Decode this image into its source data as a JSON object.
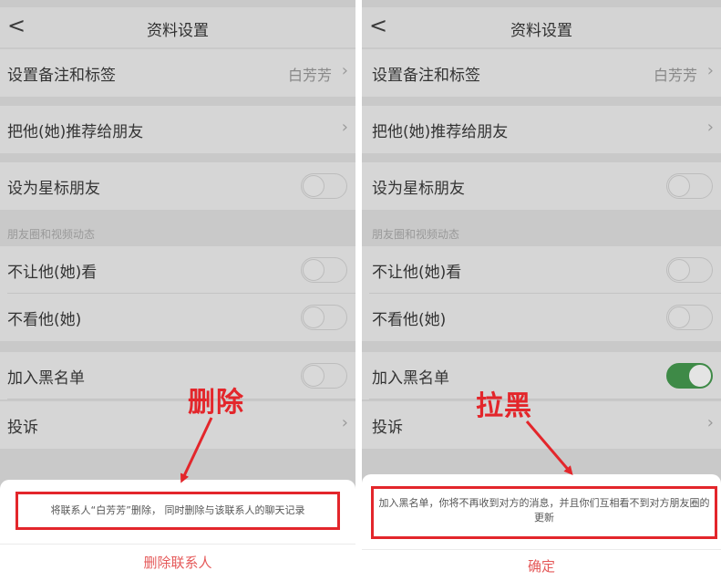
{
  "left": {
    "nav": {
      "back": "<",
      "title": "资料设置"
    },
    "rows": {
      "remark": {
        "label": "设置备注和标签",
        "value": "白芳芳"
      },
      "recommend": {
        "label": "把他(她)推荐给朋友"
      },
      "star": {
        "label": "设为星标朋友",
        "on": false
      },
      "section": "朋友圈和视频动态",
      "hide_from": {
        "label": "不让他(她)看",
        "on": false
      },
      "hide_theirs": {
        "label": "不看他(她)",
        "on": false
      },
      "blacklist": {
        "label": "加入黑名单",
        "on": false
      },
      "report": {
        "label": "投诉"
      }
    },
    "annotation": "删除",
    "sheet": {
      "message": "将联系人“白芳芳”删除， 同时删除与该联系人的聊天记录",
      "action": "删除联系人"
    }
  },
  "right": {
    "nav": {
      "back": "<",
      "title": "资料设置"
    },
    "rows": {
      "remark": {
        "label": "设置备注和标签",
        "value": "白芳芳"
      },
      "recommend": {
        "label": "把他(她)推荐给朋友"
      },
      "star": {
        "label": "设为星标朋友",
        "on": false
      },
      "section": "朋友圈和视频动态",
      "hide_from": {
        "label": "不让他(她)看",
        "on": false
      },
      "hide_theirs": {
        "label": "不看他(她)",
        "on": false
      },
      "blacklist": {
        "label": "加入黑名单",
        "on": true
      },
      "report": {
        "label": "投诉"
      }
    },
    "annotation": "拉黑",
    "sheet": {
      "message": "加入黑名单，你将不再收到对方的消息，并且你们互相看不到对方朋友圈的更新",
      "action": "确定"
    }
  },
  "colors": {
    "annotation_red": "#e3262b",
    "toggle_on": "#3e8a47",
    "action_text": "#e55a5a"
  },
  "icons": {
    "back": "chevron-left-icon",
    "row_arrow": "chevron-right-icon"
  }
}
